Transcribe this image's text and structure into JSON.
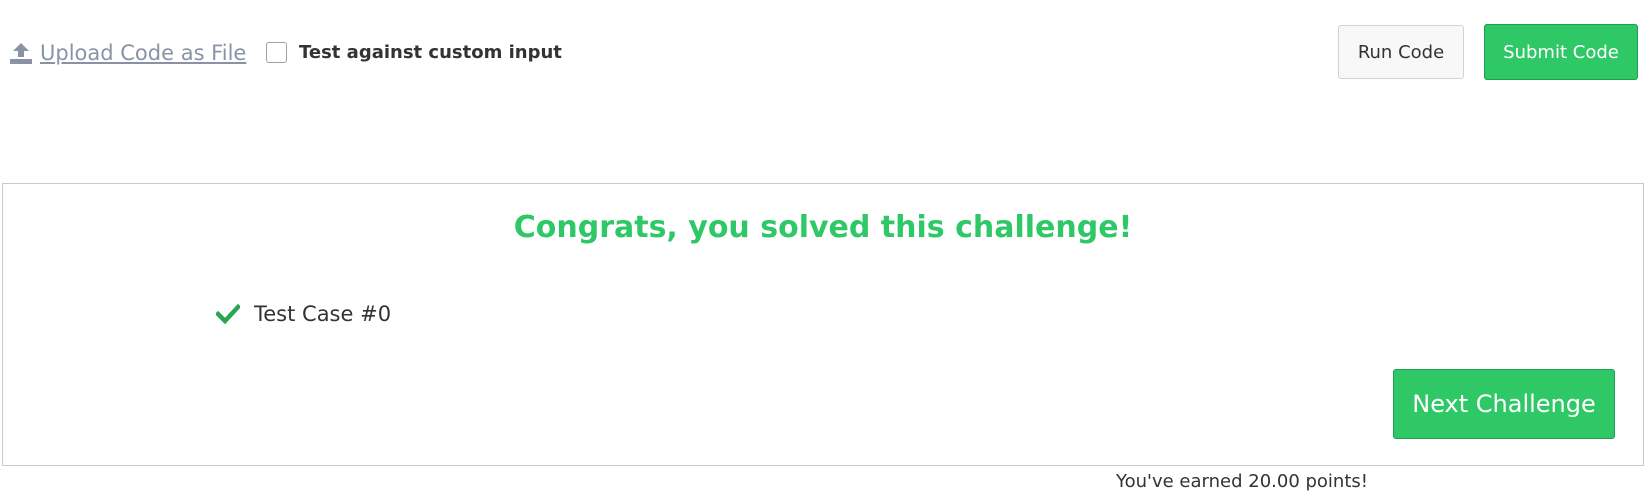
{
  "toolbar": {
    "upload_label": "Upload Code as File",
    "upload_icon": "upload-icon",
    "custom_input_label": "Test against custom input",
    "custom_input_checked": false,
    "run_label": "Run Code",
    "submit_label": "Submit Code"
  },
  "result": {
    "message": "Congrats, you solved this challenge!",
    "testcases": [
      {
        "label": "Test Case #0",
        "status": "passed",
        "icon": "checkmark-icon"
      }
    ],
    "next_label": "Next Challenge"
  },
  "footer": {
    "earned_text": "You've earned 20.00 points!"
  },
  "colors": {
    "accent_green": "#2ec866",
    "link_gray": "#8a93a6",
    "border_gray": "#c8c8c8"
  }
}
